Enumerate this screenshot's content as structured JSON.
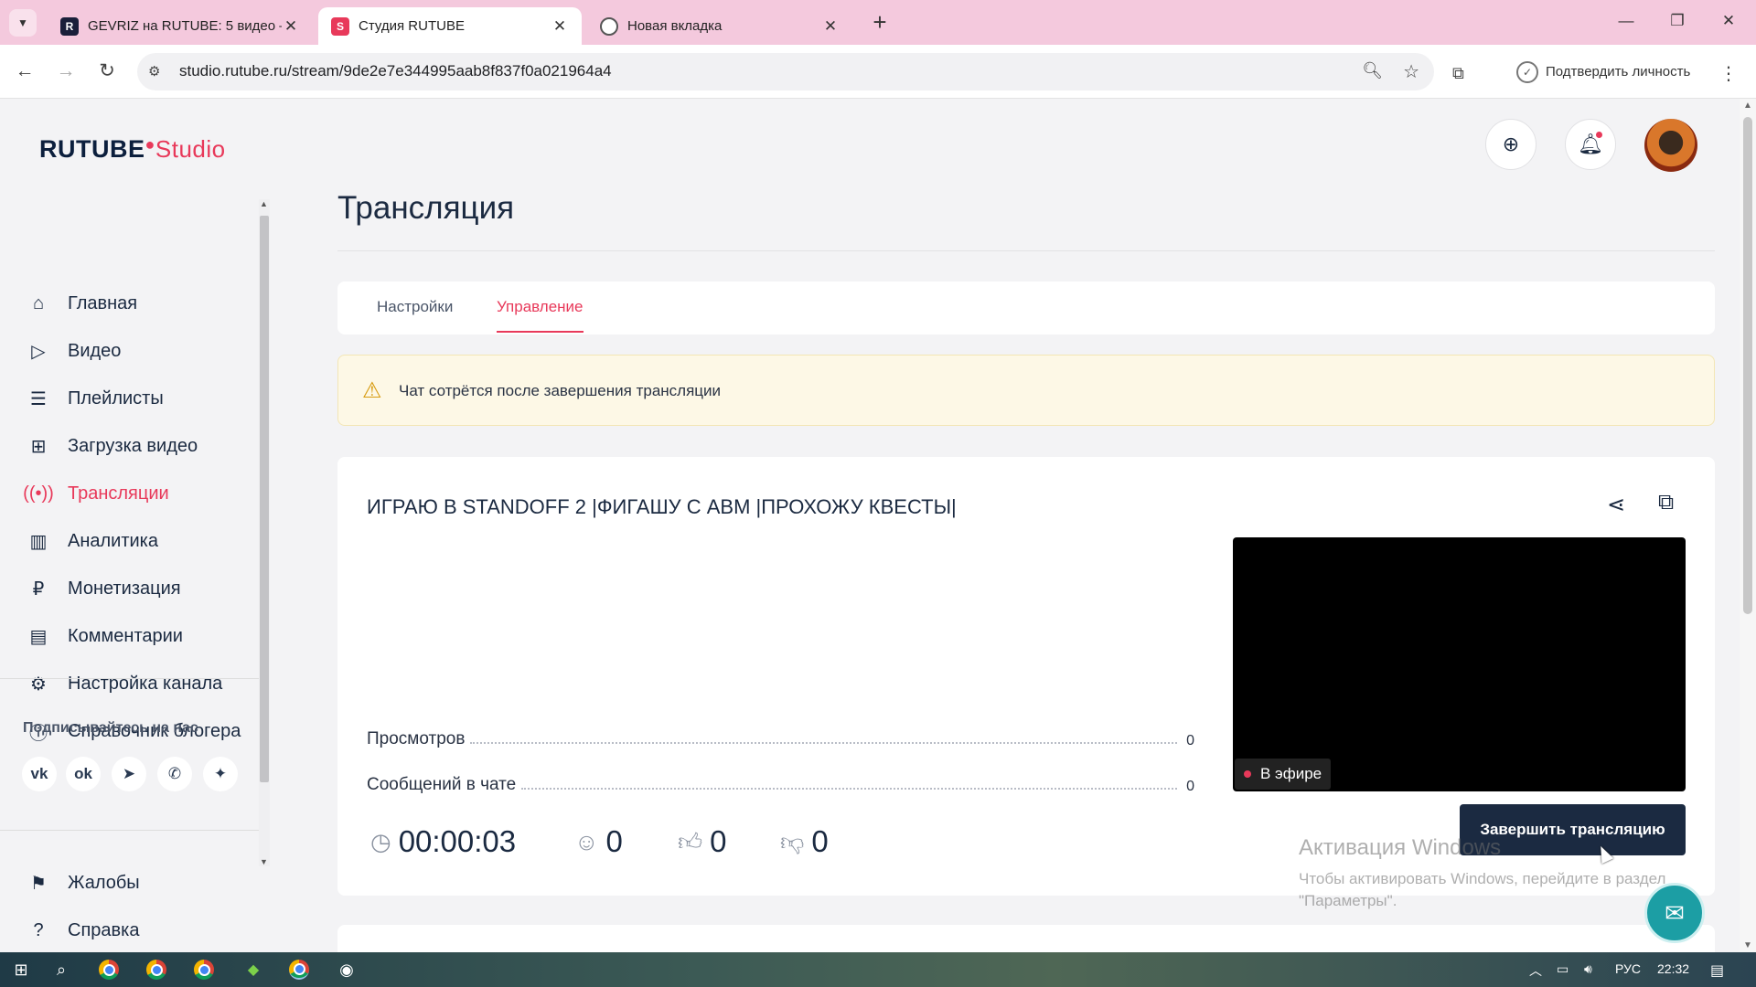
{
  "browser": {
    "tabs": [
      {
        "title": "GEVRIZ на RUTUBE: 5 видео – с",
        "active": false
      },
      {
        "title": "Студия RUTUBE",
        "active": true
      },
      {
        "title": "Новая вкладка",
        "active": false
      }
    ],
    "url": "studio.rutube.ru/stream/9de2e7e344995aab8f837f0a021964a4",
    "verify_label": "Подтвердить личность"
  },
  "app": {
    "logo_main": "RUTUBE",
    "logo_studio": "Studio"
  },
  "sidebar": {
    "items": [
      {
        "label": "Главная",
        "icon": "home-icon"
      },
      {
        "label": "Видео",
        "icon": "video-icon"
      },
      {
        "label": "Плейлисты",
        "icon": "playlist-icon"
      },
      {
        "label": "Загрузка видео",
        "icon": "upload-icon"
      },
      {
        "label": "Трансляции",
        "icon": "broadcast-icon",
        "active": true
      },
      {
        "label": "Аналитика",
        "icon": "analytics-icon"
      },
      {
        "label": "Монетизация",
        "icon": "ruble-icon"
      },
      {
        "label": "Комментарии",
        "icon": "comment-icon"
      },
      {
        "label": "Настройка канала",
        "icon": "gear-icon"
      },
      {
        "label": "Справочник блогера",
        "icon": "guide-icon"
      }
    ],
    "subscribe_label": "Подписывайтесь на нас",
    "social": [
      "vk",
      "ok",
      "telegram",
      "viber",
      "more"
    ],
    "bottom_items": [
      {
        "label": "Жалобы",
        "icon": "flag-icon"
      },
      {
        "label": "Справка",
        "icon": "help-icon"
      }
    ]
  },
  "main": {
    "title": "Трансляция",
    "tabs": [
      {
        "label": "Настройки",
        "active": false
      },
      {
        "label": "Управление",
        "active": true
      }
    ],
    "alert": "Чат сотрётся после завершения трансляции",
    "stream": {
      "title": "ИГРАЮ В STANDOFF 2 |ФИГАШУ С АВМ |ПРОХОЖУ КВЕСТЫ|",
      "stats": [
        {
          "label": "Просмотров",
          "value": "0"
        },
        {
          "label": "Сообщений в чате",
          "value": "0"
        }
      ],
      "live_label": "В эфире",
      "duration": "00:00:03",
      "viewers": "0",
      "likes": "0",
      "dislikes": "0",
      "end_button": "Завершить трансляцию"
    }
  },
  "overlay": {
    "watermark_title": "Активация Windows",
    "watermark_text_1": "Чтобы активировать Windows, перейдите в раздел",
    "watermark_text_2": "\"Параметры\"."
  },
  "taskbar": {
    "lang": "РУС",
    "time": "22:32"
  },
  "colors": {
    "accent": "#e8395a",
    "navy": "#1b2a41",
    "tabbar": "#f4c9dd",
    "alert_bg": "#fdf8e6"
  }
}
